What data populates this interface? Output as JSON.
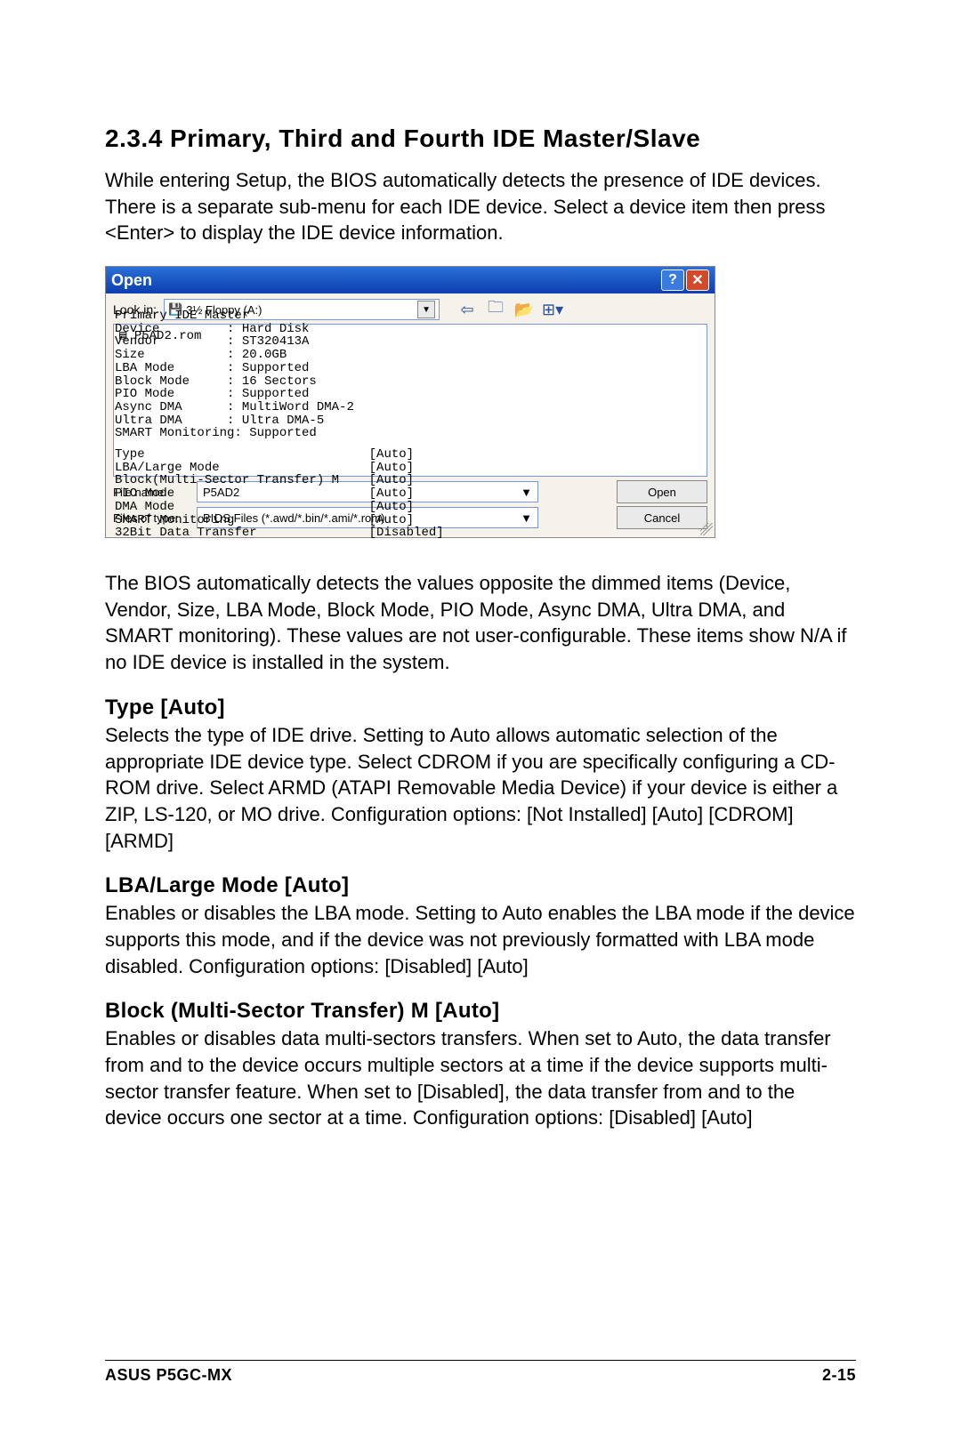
{
  "heading": "2.3.4  Primary, Third and Fourth IDE Master/Slave",
  "intro": "While entering Setup, the BIOS automatically detects the presence of IDE devices. There is a separate sub-menu for each IDE device. Select a device item then press <Enter> to display the IDE device information.",
  "dialog": {
    "title": "Open",
    "help_label": "?",
    "close_label": "✕",
    "lookin_label": "Look in:",
    "lookin_value": "3½ Floppy (A:)",
    "file_item": "P5AD2.rom",
    "file_name_label": "File name:",
    "file_name_value": "P5AD2",
    "file_type_label": "Files of type:",
    "file_type_value": "BIOS Files (*.awd/*.bin/*.ami/*.rom)",
    "open_btn": "Open",
    "cancel_btn": "Cancel"
  },
  "bios1": "Primary IDE Master\nDevice         : Hard Disk\nVendor         : ST320413A\nSize           : 20.0GB\nLBA Mode       : Supported\nBlock Mode     : 16 Sectors\nPIO Mode       : Supported\nAsync DMA      : MultiWord DMA-2\nUltra DMA      : Ultra DMA-5\nSMART Monitoring: Supported",
  "bios2": "Type                              [Auto]\nLBA/Large Mode                    [Auto]\nBlock(Multi-Sector Transfer) M    [Auto]\nPIO Mode                          [Auto]\nDMA Mode                          [Auto]\nSMART Monitoring                  [Auto]\n32Bit Data Transfer               [Disabled]",
  "para_after_shot": "The BIOS automatically detects the values opposite the dimmed items (Device, Vendor, Size, LBA Mode, Block Mode, PIO Mode, Async DMA, Ultra DMA, and SMART monitoring). These values are not user-configurable. These items show N/A if no IDE device is installed in the system.",
  "sections": {
    "type_h": "Type [Auto]",
    "type_p": "Selects the type of IDE drive. Setting to Auto allows automatic selection of the appropriate IDE device type. Select CDROM if you are specifically configuring a CD-ROM drive. Select ARMD (ATAPI Removable Media Device) if your device is either a ZIP, LS-120, or MO drive. Configuration options: [Not Installed] [Auto] [CDROM] [ARMD]",
    "lba_h": "LBA/Large Mode [Auto]",
    "lba_p": "Enables or disables the LBA mode. Setting to Auto enables the LBA mode if the device supports this mode, and if the device was not previously formatted with LBA mode disabled. Configuration options: [Disabled] [Auto]",
    "block_h": "Block (Multi-Sector Transfer) M [Auto]",
    "block_p": "Enables or disables data multi-sectors transfers. When set to Auto, the data transfer from and to the device occurs multiple sectors at a time if the device supports multi-sector transfer feature. When set to [Disabled], the data transfer from and to the device occurs one sector at a time. Configuration options: [Disabled] [Auto]"
  },
  "footer_left": "ASUS P5GC-MX",
  "footer_right": "2-15"
}
